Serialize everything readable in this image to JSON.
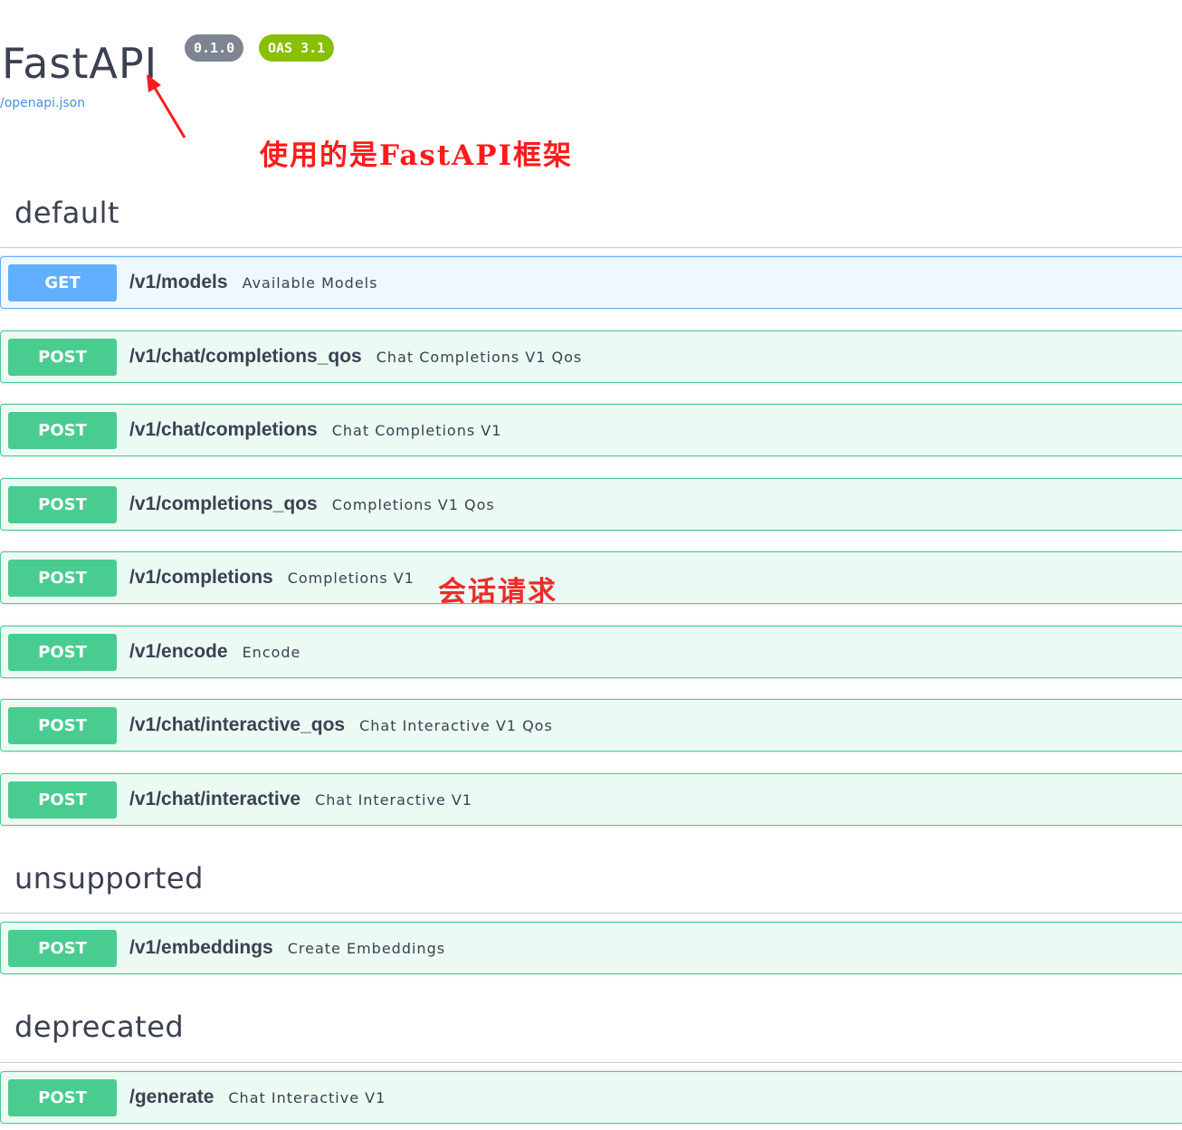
{
  "header": {
    "title": "FastAPI",
    "version_badge": "0.1.0",
    "oas_badge": "OAS 3.1",
    "spec_link": "/openapi.json"
  },
  "annotations": {
    "framework_note": "使用的是FastAPI框架",
    "session_note": "会话请求",
    "color": "#ff1a1a"
  },
  "colors": {
    "get": "#61affe",
    "post": "#49cc90"
  },
  "sections": [
    {
      "title": "default",
      "operations": [
        {
          "method": "GET",
          "path": "/v1/models",
          "summary": "Available Models"
        },
        {
          "method": "POST",
          "path": "/v1/chat/completions_qos",
          "summary": "Chat Completions V1 Qos"
        },
        {
          "method": "POST",
          "path": "/v1/chat/completions",
          "summary": "Chat Completions V1"
        },
        {
          "method": "POST",
          "path": "/v1/completions_qos",
          "summary": "Completions V1 Qos"
        },
        {
          "method": "POST",
          "path": "/v1/completions",
          "summary": "Completions V1"
        },
        {
          "method": "POST",
          "path": "/v1/encode",
          "summary": "Encode"
        },
        {
          "method": "POST",
          "path": "/v1/chat/interactive_qos",
          "summary": "Chat Interactive V1 Qos"
        },
        {
          "method": "POST",
          "path": "/v1/chat/interactive",
          "summary": "Chat Interactive V1"
        }
      ]
    },
    {
      "title": "unsupported",
      "operations": [
        {
          "method": "POST",
          "path": "/v1/embeddings",
          "summary": "Create Embeddings"
        }
      ]
    },
    {
      "title": "deprecated",
      "operations": [
        {
          "method": "POST",
          "path": "/generate",
          "summary": "Chat Interactive V1"
        }
      ]
    }
  ]
}
